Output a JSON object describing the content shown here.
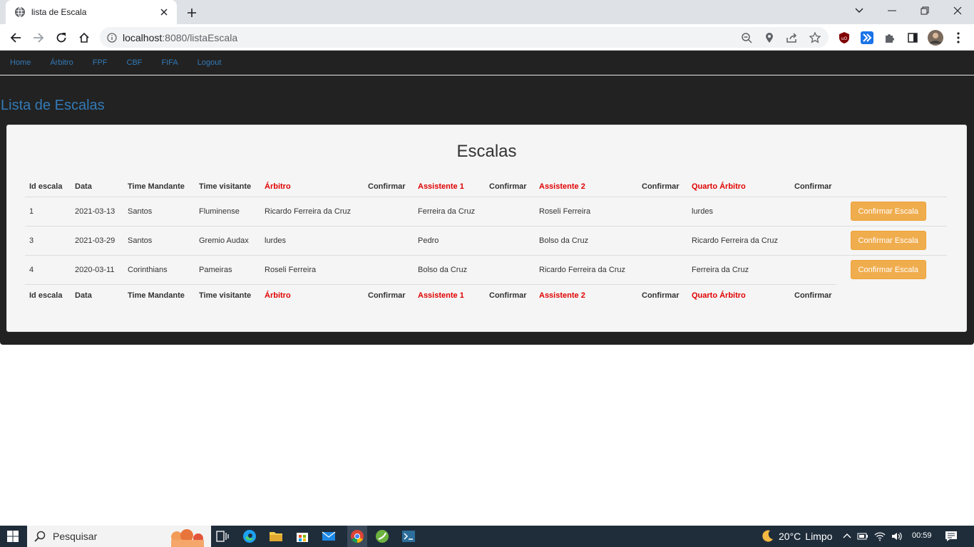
{
  "browser": {
    "tab_title": "lista de Escala",
    "url_host": "localhost",
    "url_rest": ":8080/listaEscala"
  },
  "nav": {
    "items": [
      "Home",
      "Árbitro",
      "FPF",
      "CBF",
      "FIFA",
      "Logout"
    ]
  },
  "page": {
    "title": "Lista de Escalas",
    "panel_title": "Escalas"
  },
  "table": {
    "headers": [
      "Id escala",
      "Data",
      "Time Mandante",
      "Time visitante",
      "Árbitro",
      "Confirmar",
      "Assistente 1",
      "Confirmar",
      "Assistente 2",
      "Confirmar",
      "Quarto Árbitro",
      "Confirmar"
    ],
    "rows": [
      {
        "id": "1",
        "data": "2021-03-13",
        "mandante": "Santos",
        "visitante": "Fluminense",
        "arbitro": "Ricardo Ferreira da Cruz",
        "assistente1": "Ferreira da Cruz",
        "assistente2": "Roseli Ferreira",
        "quarto": "lurdes",
        "button": "Confirmar Escala"
      },
      {
        "id": "3",
        "data": "2021-03-29",
        "mandante": "Santos",
        "visitante": "Gremio Audax",
        "arbitro": "lurdes",
        "assistente1": "Pedro",
        "assistente2": "Bolso da Cruz",
        "quarto": "Ricardo Ferreira da Cruz",
        "button": "Confirmar Escala"
      },
      {
        "id": "4",
        "data": "2020-03-11",
        "mandante": "Corinthians",
        "visitante": "Pameiras",
        "arbitro": "Roseli Ferreira",
        "assistente1": "Bolso da Cruz",
        "assistente2": "Ricardo Ferreira da Cruz",
        "quarto": "Ferreira da Cruz",
        "button": "Confirmar Escala"
      }
    ]
  },
  "taskbar": {
    "search_placeholder": "Pesquisar",
    "temperature": "20°C",
    "weather": "Limpo",
    "time": "00:59"
  }
}
